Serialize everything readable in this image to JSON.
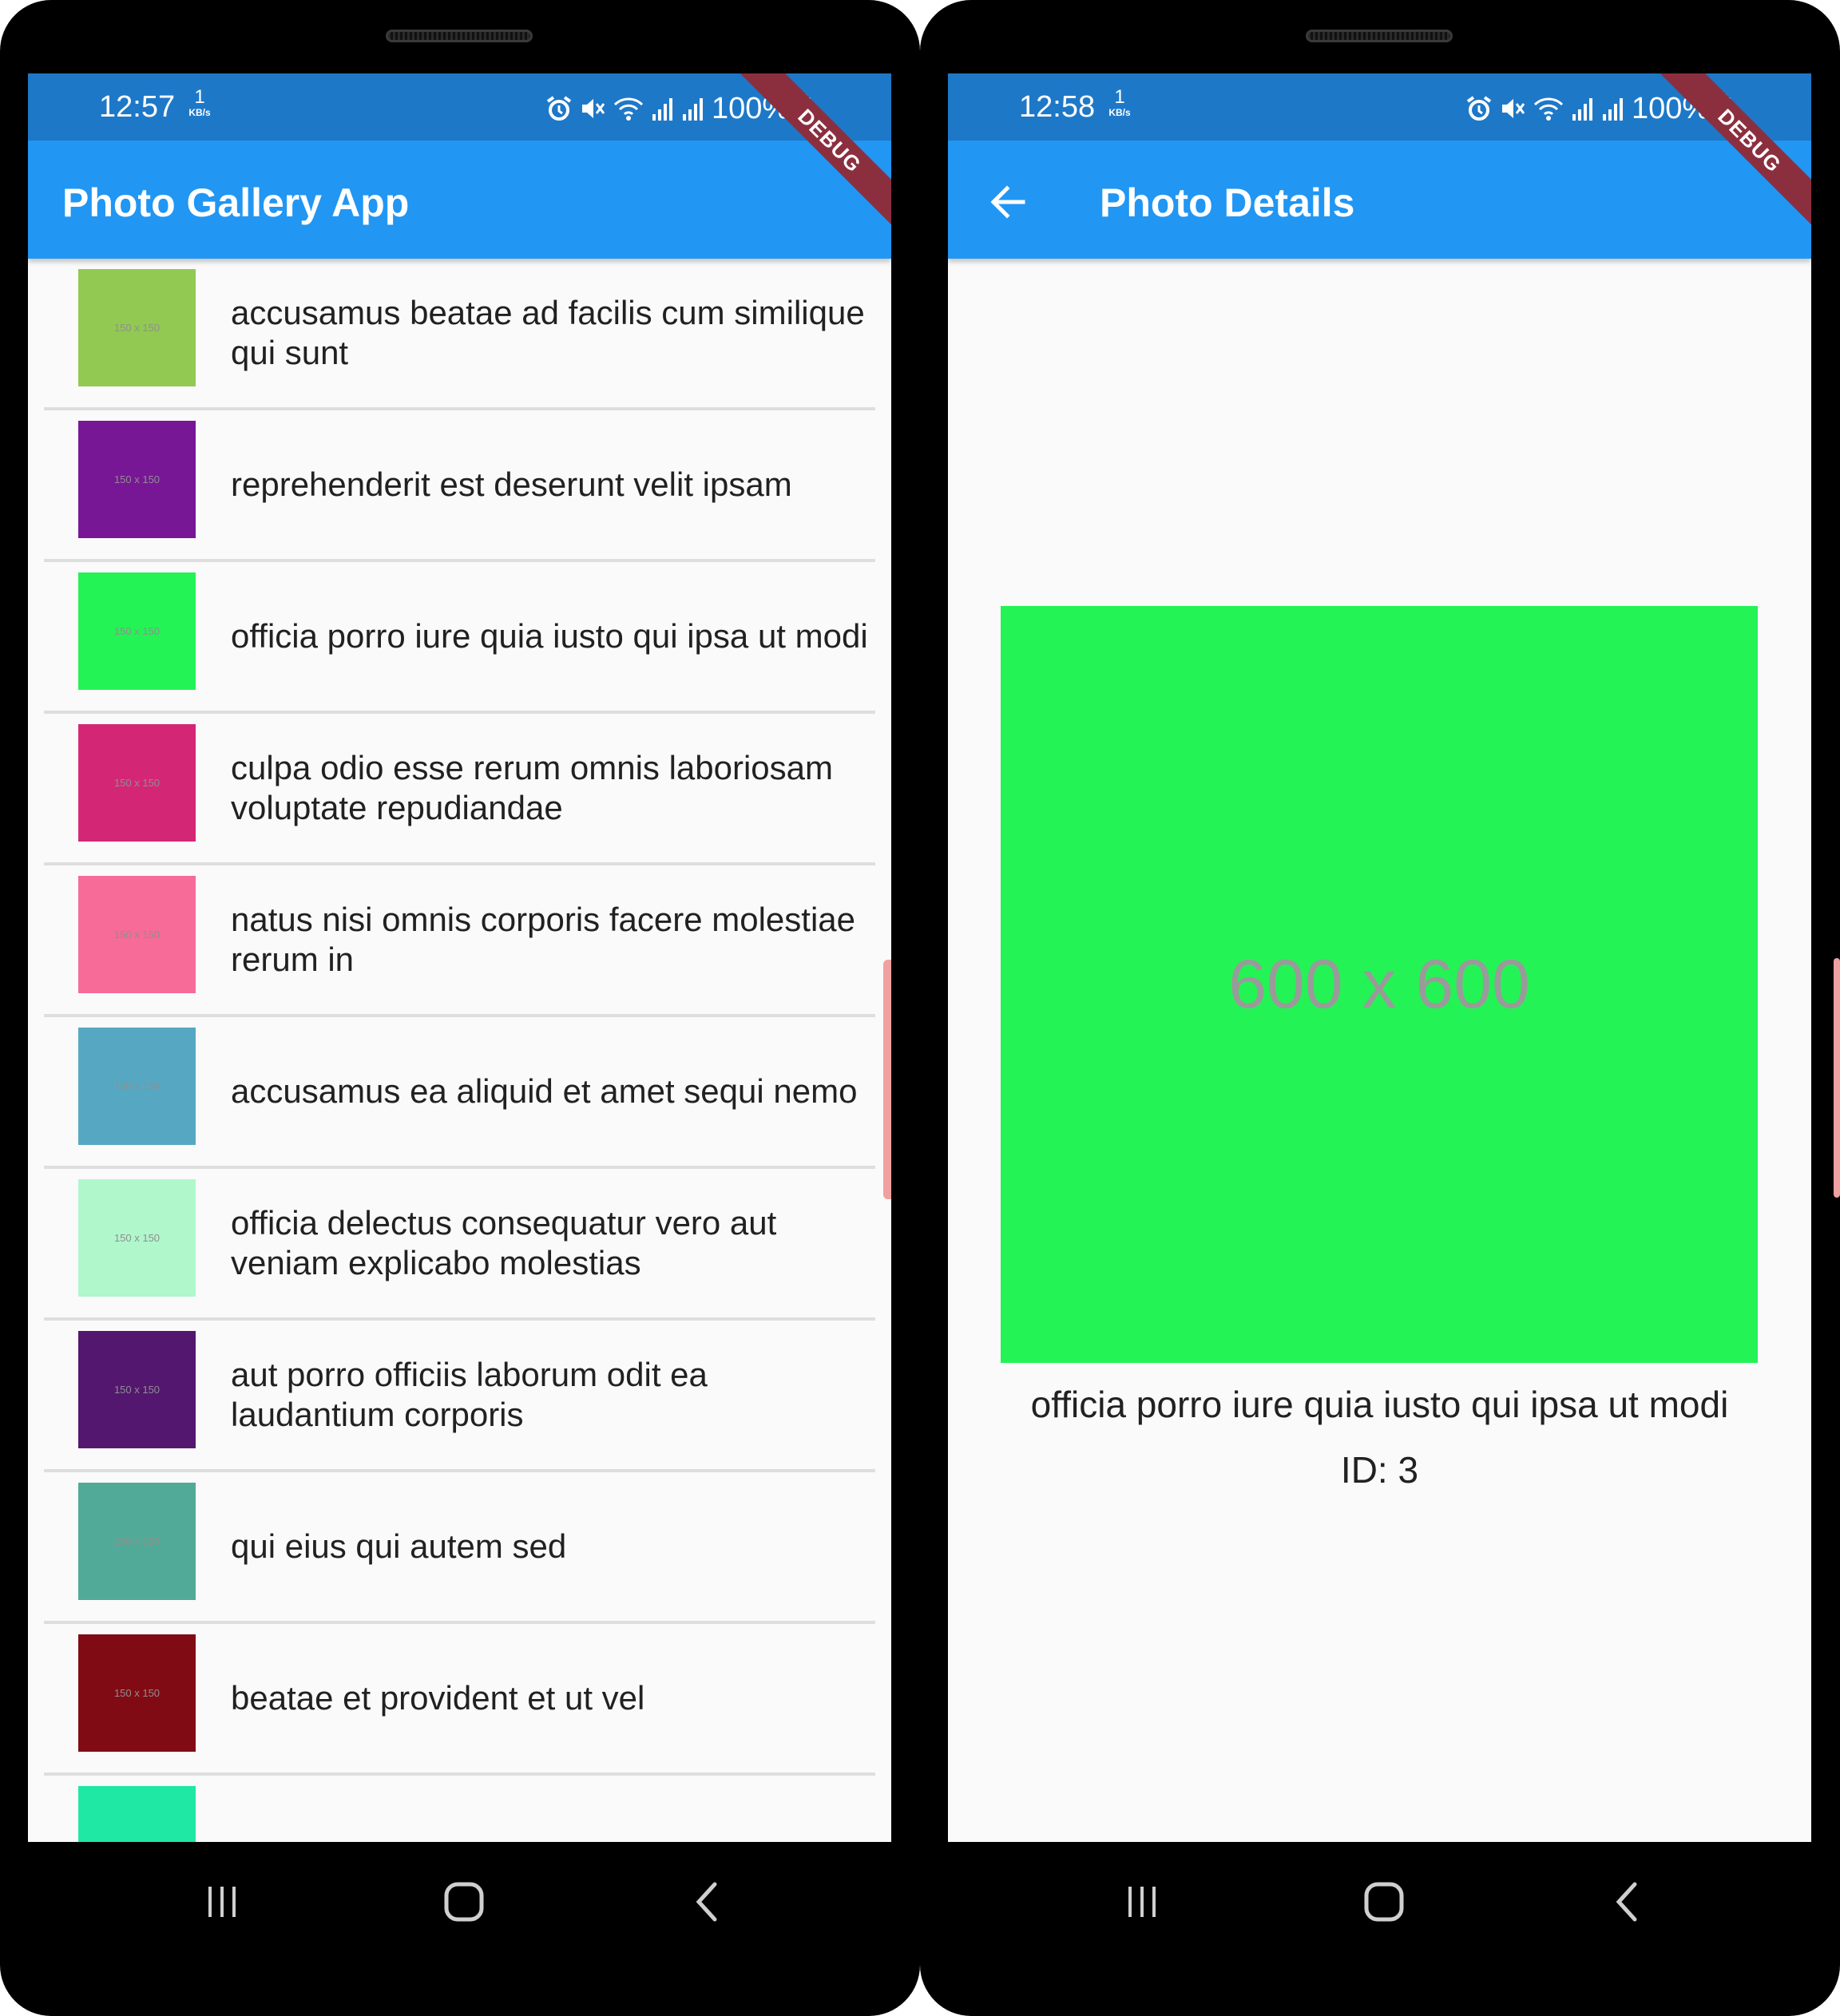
{
  "colors": {
    "status_bar": "#1e78c8",
    "app_bar": "#2196f3",
    "screen_background": "#fafafa",
    "divider": "#dedede",
    "debug_ribbon": "#8b2f3f"
  },
  "left_phone": {
    "status": {
      "time": "12:57",
      "net_speed_value": "1",
      "net_speed_unit": "KB/s",
      "battery": "100%"
    },
    "debug_label": "DEBUG",
    "app_bar": {
      "title": "Photo Gallery App"
    },
    "photos": [
      {
        "title": "accusamus beatae ad facilis cum similique qui sunt",
        "thumb_color": "#92c952",
        "thumb_label": "150 x 150"
      },
      {
        "title": "reprehenderit est deserunt velit ipsam",
        "thumb_color": "#771796",
        "thumb_label": "150 x 150"
      },
      {
        "title": "officia porro iure quia iusto qui ipsa ut modi",
        "thumb_color": "#24f355",
        "thumb_label": "150 x 150"
      },
      {
        "title": "culpa odio esse rerum omnis laboriosam voluptate repudiandae",
        "thumb_color": "#d32776",
        "thumb_label": "150 x 150"
      },
      {
        "title": "natus nisi omnis corporis facere molestiae rerum in",
        "thumb_color": "#f66b97",
        "thumb_label": "150 x 150"
      },
      {
        "title": "accusamus ea aliquid et amet sequi nemo",
        "thumb_color": "#56a8c2",
        "thumb_label": "150 x 150"
      },
      {
        "title": "officia delectus consequatur vero aut veniam explicabo molestias",
        "thumb_color": "#b0f7cc",
        "thumb_label": "150 x 150"
      },
      {
        "title": "aut porro officiis laborum odit ea laudantium corporis",
        "thumb_color": "#54176f",
        "thumb_label": "150 x 150"
      },
      {
        "title": "qui eius qui autem sed",
        "thumb_color": "#51aa97",
        "thumb_label": "150 x 150"
      },
      {
        "title": "beatae et provident et ut vel",
        "thumb_color": "#810b14",
        "thumb_label": "150 x 150"
      },
      {
        "title": "",
        "thumb_color": "#1ee8a4",
        "thumb_label": ""
      }
    ]
  },
  "right_phone": {
    "status": {
      "time": "12:58",
      "net_speed_value": "1",
      "net_speed_unit": "KB/s",
      "battery": "100%"
    },
    "debug_label": "DEBUG",
    "app_bar": {
      "title": "Photo Details",
      "back_icon": "arrow-back-icon"
    },
    "photo": {
      "image_label": "600 x 600",
      "image_color": "#24f355",
      "title": "officia porro iure quia iusto qui ipsa ut modi",
      "id_text": "ID: 3"
    }
  },
  "nav_bar": {
    "recents_icon": "recents-icon",
    "home_icon": "home-icon",
    "back_icon": "nav-back-icon"
  }
}
